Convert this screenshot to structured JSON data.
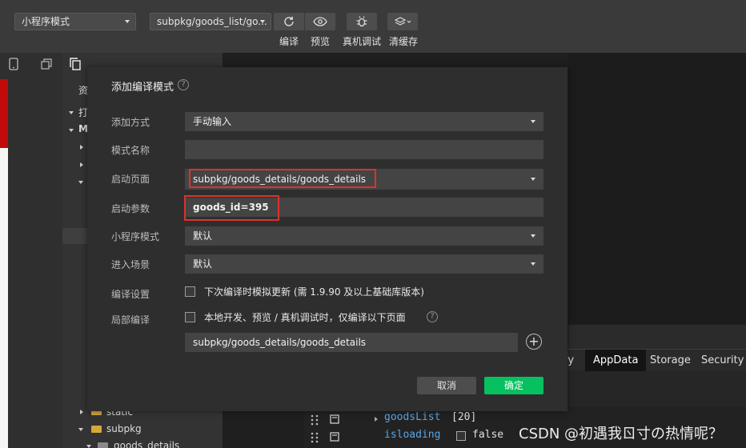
{
  "toolbar": {
    "mode_select": "小程序模式",
    "page_select": "subpkg/goods_list/go...",
    "buttons": [
      {
        "label": "编译",
        "icon": "refresh-icon"
      },
      {
        "label": "预览",
        "icon": "eye-icon"
      },
      {
        "label": "真机调试",
        "icon": "bug-icon"
      },
      {
        "label": "清缓存",
        "icon": "layers-icon"
      }
    ]
  },
  "explorer": {
    "header_label": "资",
    "tree_short": [
      "打",
      "M"
    ],
    "tree_items": [
      "static",
      "subpkg",
      "goods_details"
    ]
  },
  "dialog": {
    "title": "添加编译模式",
    "rows": {
      "add_method_label": "添加方式",
      "add_method_value": "手动输入",
      "mode_name_label": "模式名称",
      "mode_name_value": "",
      "launch_page_label": "启动页面",
      "launch_page_value": "subpkg/goods_details/goods_details",
      "launch_params_label": "启动参数",
      "launch_params_value": "goods_id=395",
      "mini_mode_label": "小程序模式",
      "mini_mode_value": "默认",
      "scene_label": "进入场景",
      "scene_value": "默认",
      "compile_settings_label": "编译设置",
      "compile_settings_option": "下次编译时模拟更新 (需 1.9.90 及以上基础库版本)",
      "partial_compile_label": "局部编译",
      "partial_compile_option": "本地开发、预览 / 真机调试时，仅编译以下页面",
      "partial_page_value": "subpkg/goods_details/goods_details"
    },
    "cancel_label": "取消",
    "ok_label": "确定"
  },
  "debugger": {
    "tabs": [
      "ry",
      "AppData",
      "Storage",
      "Security"
    ],
    "active_tab": "AppData",
    "rows": [
      {
        "key": "goodsList",
        "value": "[20]"
      },
      {
        "key": "isloading",
        "value": "false"
      }
    ]
  },
  "watermark": "CSDN @初遇我ㄖ寸の热情呢？",
  "colors": {
    "accent_green": "#07c160",
    "highlight_red": "#d9342c",
    "simulator_red": "#c20a0a"
  }
}
